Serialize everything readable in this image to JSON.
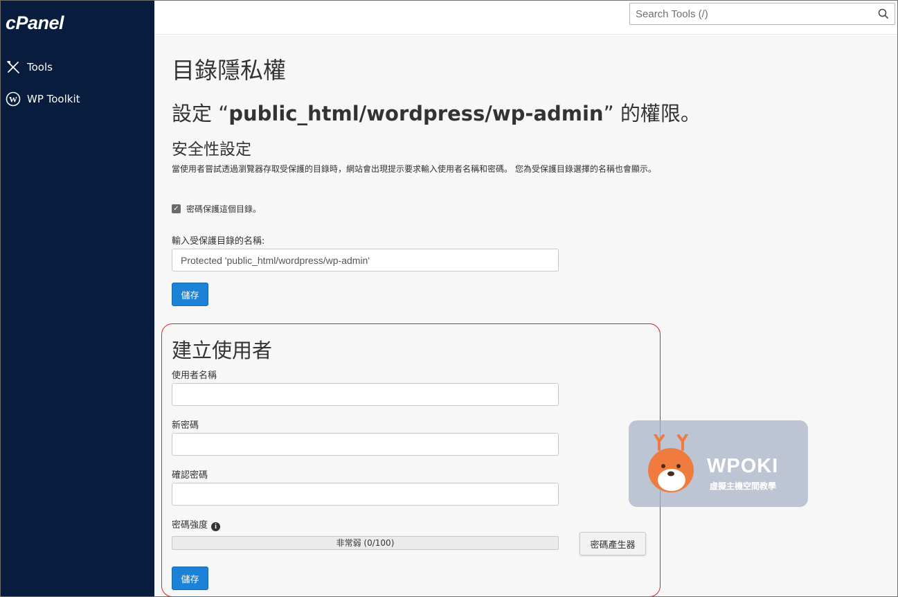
{
  "sidebar": {
    "logo": "cPanel",
    "items": [
      {
        "label": "Tools",
        "icon": "tools-icon"
      },
      {
        "label": "WP Toolkit",
        "icon": "wordpress-icon"
      }
    ]
  },
  "search": {
    "placeholder": "Search Tools (/)",
    "value": ""
  },
  "main": {
    "page_title": "目錄隱私權",
    "permissions_prefix": "設定 “",
    "permissions_path": "public_html/wordpress/wp-admin",
    "permissions_suffix": "” 的權限。",
    "security": {
      "title": "安全性設定",
      "description": "當使用者嘗試透過瀏覽器存取受保護的目錄時，網站會出現提示要求輸入使用者名稱和密碼。 您為受保護目錄選擇的名稱也會顯示。",
      "protect_checkbox_label": "密碼保護這個目錄。",
      "protect_checked": true,
      "name_label": "輸入受保護目錄的名稱:",
      "name_value": "Protected 'public_html/wordpress/wp-admin'",
      "save_label": "儲存"
    },
    "create_user": {
      "title": "建立使用者",
      "username_label": "使用者名稱",
      "username_value": "",
      "new_password_label": "新密碼",
      "new_password_value": "",
      "confirm_password_label": "確認密碼",
      "confirm_password_value": "",
      "strength_label": "密碼強度",
      "strength_text": "非常弱 (0/100)",
      "strength_value": 0,
      "generator_label": "密碼產生器",
      "save_label": "儲存"
    }
  },
  "watermark": {
    "brand": "WPOKI",
    "subtitle": "虛擬主機空間教學"
  },
  "colors": {
    "sidebar_bg": "#081c3e",
    "primary_button": "#1b82d7",
    "highlight_border": "#d9232a"
  }
}
